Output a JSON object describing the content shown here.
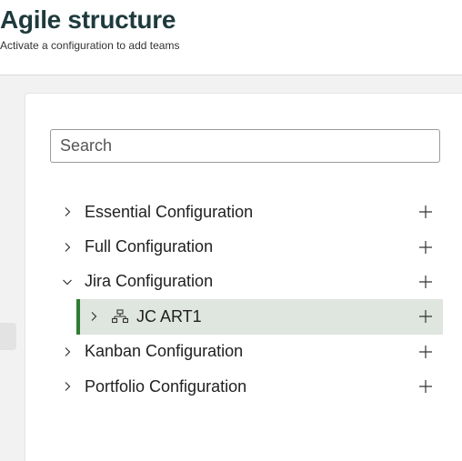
{
  "header": {
    "title": "Agile structure",
    "subtitle": "Activate a configuration to add teams"
  },
  "search": {
    "placeholder": "Search",
    "value": ""
  },
  "tree": {
    "items": [
      {
        "label": "Essential Configuration",
        "expanded": false
      },
      {
        "label": "Full Configuration",
        "expanded": false
      },
      {
        "label": "Jira Configuration",
        "expanded": true
      },
      {
        "label": "JC ART1",
        "expanded": false,
        "selected": true,
        "icon": "hierarchy-icon"
      },
      {
        "label": "Kanban Configuration",
        "expanded": false
      },
      {
        "label": "Portfolio Configuration",
        "expanded": false
      }
    ]
  },
  "colors": {
    "title": "#1f3a3d",
    "selected_bg": "#dfe5df",
    "selected_bar": "#2e7d32"
  }
}
